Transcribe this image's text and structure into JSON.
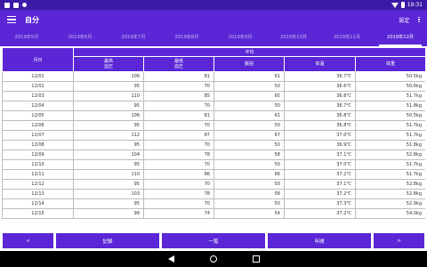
{
  "statusbar": {
    "time": "19:31"
  },
  "appbar": {
    "title": "自分",
    "settings_label": "設定"
  },
  "tabs": [
    {
      "label": "2019年5月"
    },
    {
      "label": "2019年6月"
    },
    {
      "label": "2019年7月"
    },
    {
      "label": "2019年8月"
    },
    {
      "label": "2019年9月"
    },
    {
      "label": "2019年10月"
    },
    {
      "label": "2019年11月"
    },
    {
      "label": "2019年12月"
    }
  ],
  "table": {
    "date_header": "月日",
    "group_header": "平均",
    "columns": {
      "sys": "最高\n血圧",
      "dia": "最低\n血圧",
      "pulse": "脈拍",
      "temp": "体温",
      "weight": "体重"
    },
    "rows": [
      [
        "12/01",
        "106",
        "81",
        "61",
        "36.7℃",
        "50.5kg"
      ],
      [
        "12/02",
        "95",
        "70",
        "50",
        "36.6℃",
        "50.6kg"
      ],
      [
        "12/03",
        "110",
        "85",
        "65",
        "36.8℃",
        "51.7kg"
      ],
      [
        "12/04",
        "95",
        "70",
        "50",
        "36.7℃",
        "51.8kg"
      ],
      [
        "12/05",
        "106",
        "81",
        "61",
        "36.8℃",
        "50.5kg"
      ],
      [
        "12/06",
        "95",
        "70",
        "50",
        "36.8℃",
        "51.7kg"
      ],
      [
        "12/07",
        "112",
        "87",
        "67",
        "37.0℃",
        "51.7kg"
      ],
      [
        "12/08",
        "95",
        "70",
        "50",
        "36.9℃",
        "51.8kg"
      ],
      [
        "12/09",
        "104",
        "78",
        "58",
        "37.1℃",
        "52.8kg"
      ],
      [
        "12/10",
        "95",
        "70",
        "50",
        "37.0℃",
        "51.7kg"
      ],
      [
        "12/11",
        "110",
        "86",
        "66",
        "37.2℃",
        "51.7kg"
      ],
      [
        "12/12",
        "95",
        "70",
        "50",
        "37.1℃",
        "52.8kg"
      ],
      [
        "12/13",
        "103",
        "78",
        "58",
        "37.2℃",
        "52.8kg"
      ],
      [
        "12/14",
        "95",
        "70",
        "50",
        "37.3℃",
        "52.9kg"
      ],
      [
        "12/15",
        "99",
        "74",
        "54",
        "37.2℃",
        "54.0kg"
      ]
    ]
  },
  "buttons": {
    "prev": "<",
    "record": "記録",
    "list": "一覧",
    "annual": "年間",
    "next": ">"
  }
}
